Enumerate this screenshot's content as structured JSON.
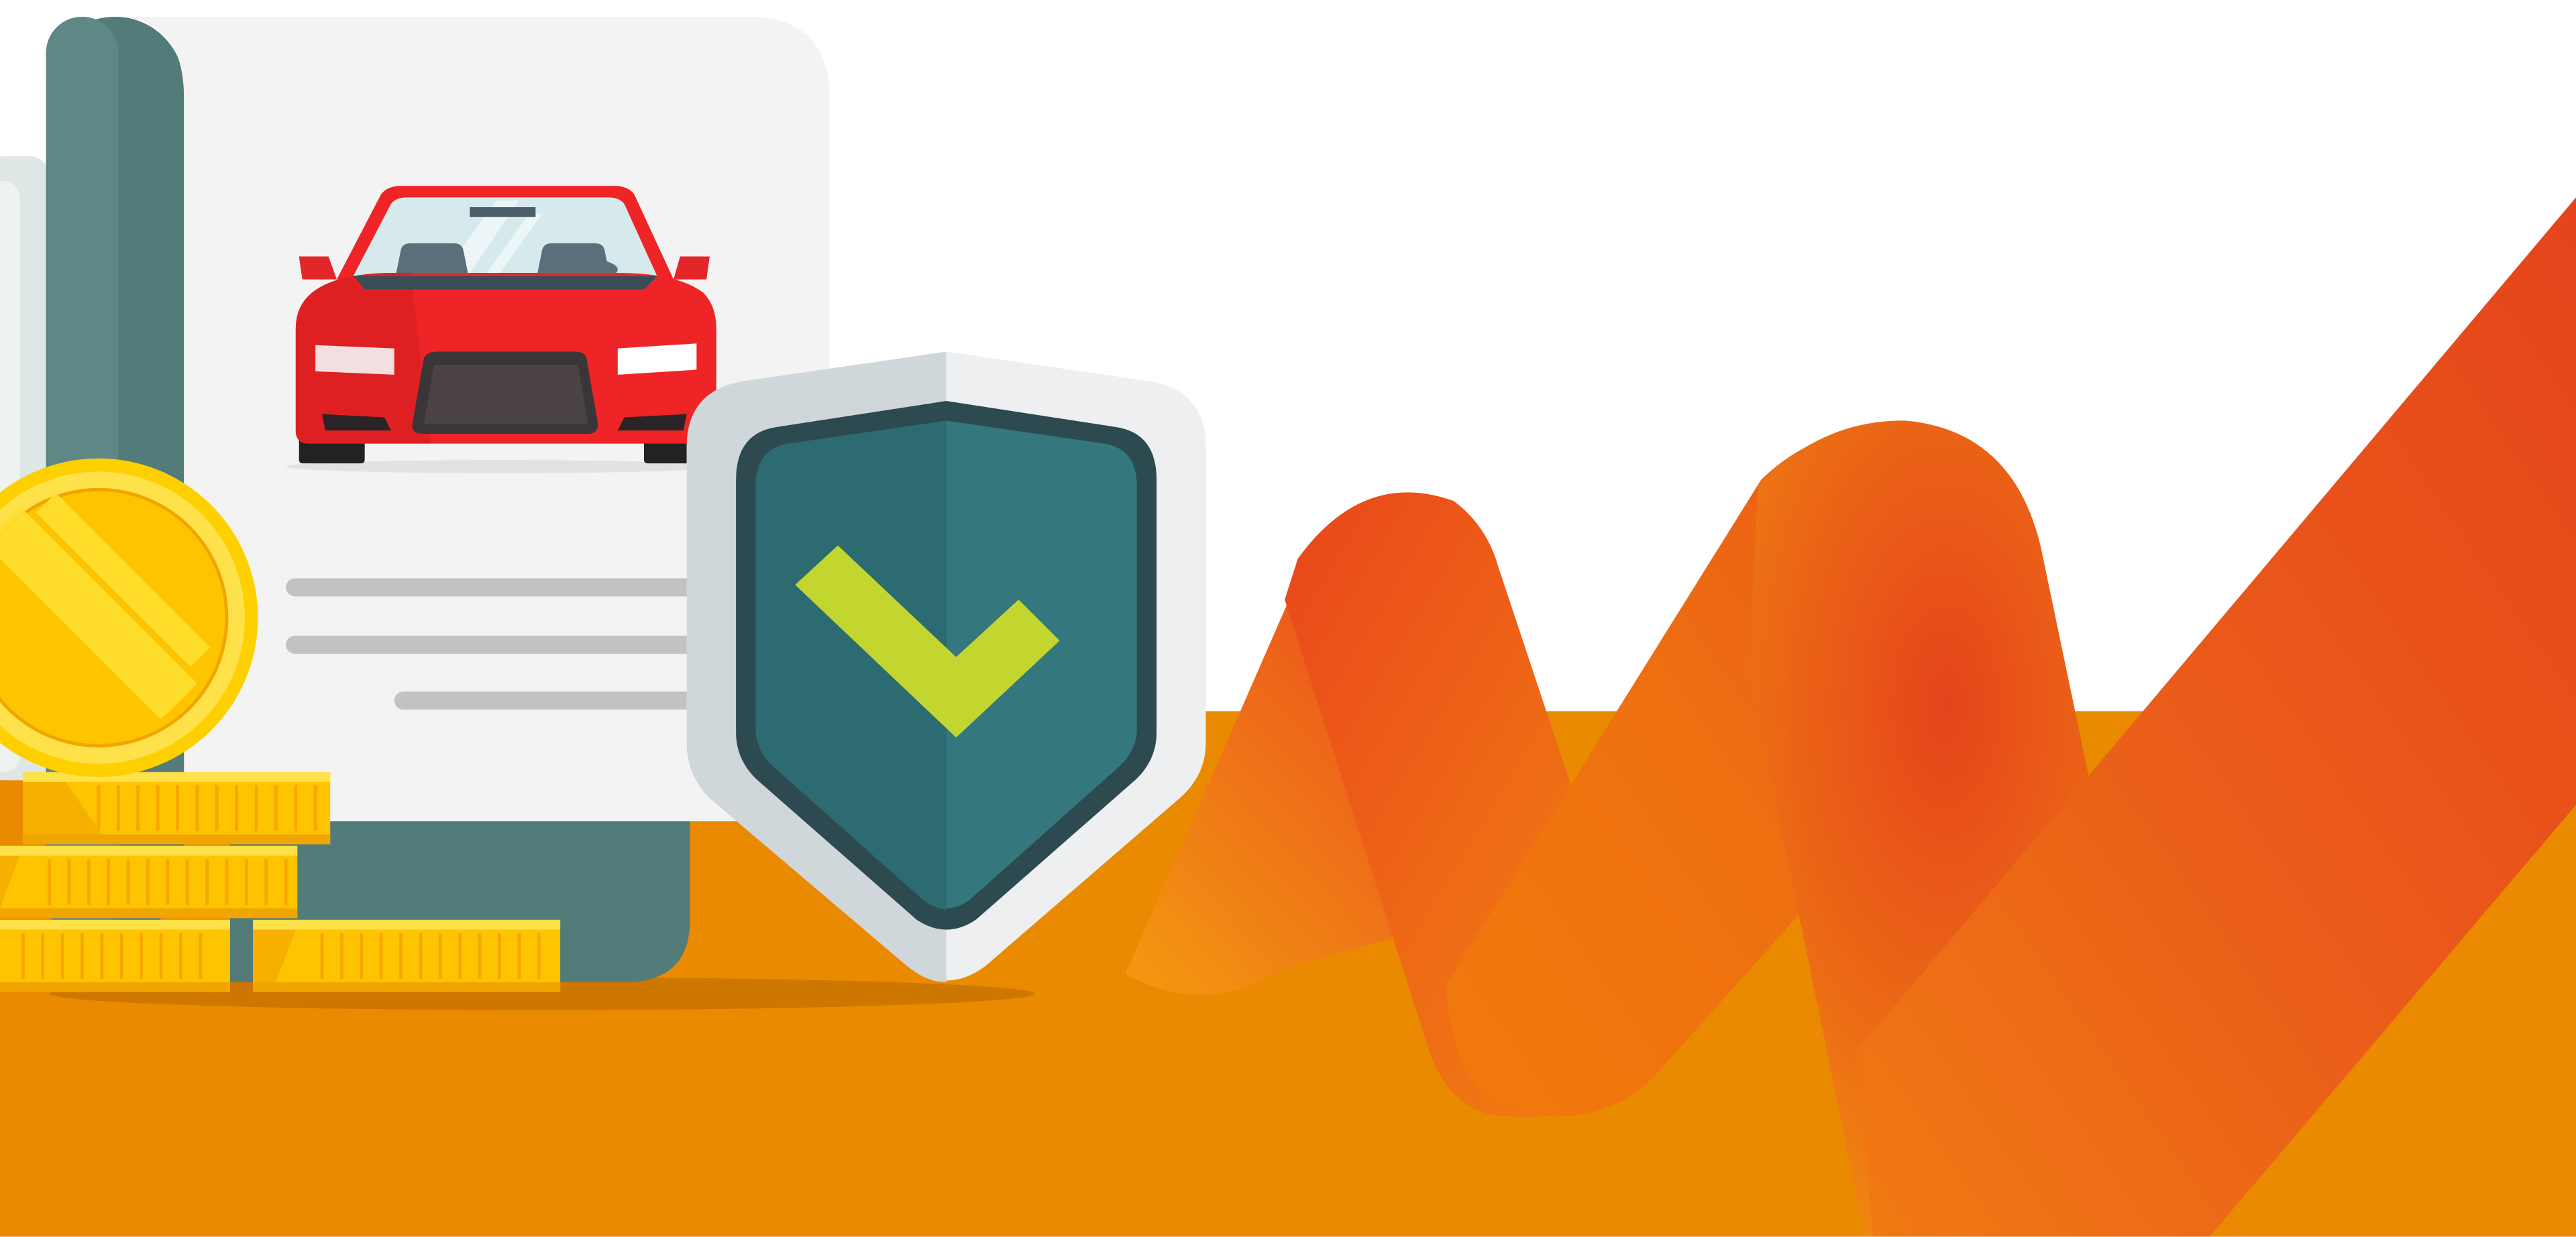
{
  "scene": {
    "subject": "car-insurance-illustration",
    "colors": {
      "background": "#ffffff",
      "ground": "#ea8a00",
      "ground_shadow": "#c97300",
      "document_paper": "#f3f3f3",
      "document_scroll": "#527b7a",
      "document_lines": "#c2c2c2",
      "car_body": "#ee2426",
      "car_windshield": "#d6e9ec",
      "shield_outer": "#eeeff0",
      "shield_outer_shade": "#d0d7da",
      "shield_inner": "#2f7479",
      "shield_rim": "#2c4a50",
      "checkmark": "#c3d62f",
      "coin_gold": "#ffc400",
      "coin_edge": "#f0a500",
      "wave_orange": "#f08000",
      "wave_red": "#e8441a"
    },
    "icons": [
      "document-icon",
      "car-icon",
      "shield-icon",
      "checkmark-icon",
      "coin-icon",
      "coin-stack-icon"
    ]
  }
}
